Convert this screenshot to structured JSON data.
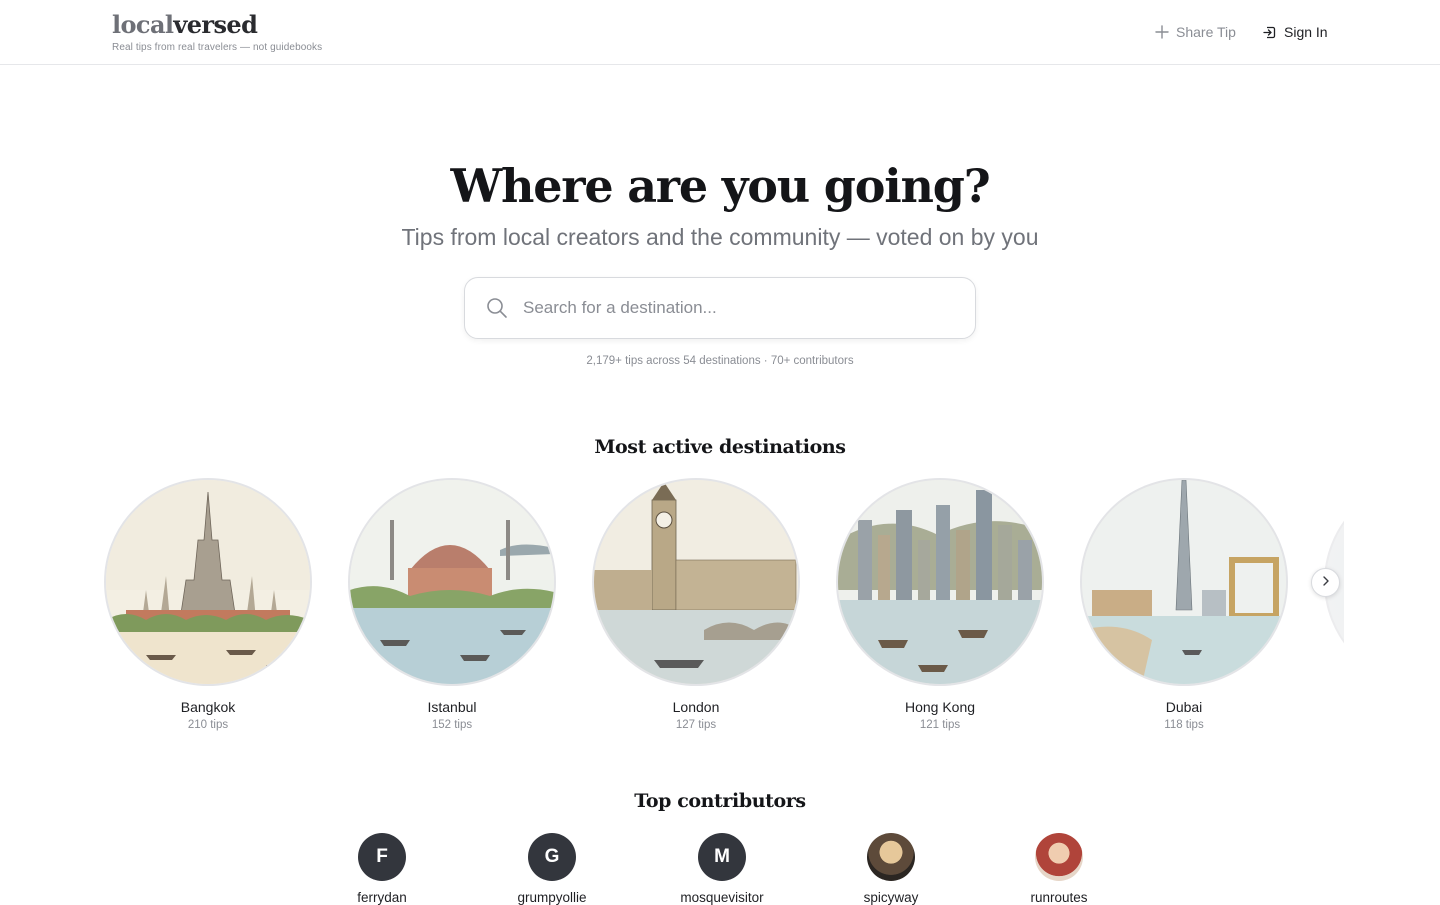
{
  "header": {
    "logo_part1": "local",
    "logo_part2": "versed",
    "tagline": "Real tips from real travelers — not guidebooks",
    "share_label": "Share Tip",
    "signin_label": "Sign In"
  },
  "hero": {
    "title": "Where are you going?",
    "subtitle": "Tips from local creators and the community — voted on by you",
    "search_placeholder": "Search for a destination...",
    "stats": "2,179+ tips across 54 destinations · 70+ contributors"
  },
  "destinations": {
    "title": "Most active destinations",
    "items": [
      {
        "name": "Bangkok",
        "count": "210 tips"
      },
      {
        "name": "Istanbul",
        "count": "152 tips"
      },
      {
        "name": "London",
        "count": "127 tips"
      },
      {
        "name": "Hong Kong",
        "count": "121 tips"
      },
      {
        "name": "Dubai",
        "count": "118 tips"
      }
    ]
  },
  "contributors": {
    "title": "Top contributors",
    "items": [
      {
        "initial": "F",
        "name": "ferrydan"
      },
      {
        "initial": "G",
        "name": "grumpyollie"
      },
      {
        "initial": "M",
        "name": "mosquevisitor"
      },
      {
        "initial": "",
        "name": "spicyway"
      },
      {
        "initial": "",
        "name": "runroutes"
      }
    ]
  },
  "colors": {
    "text": "#1f2024",
    "muted": "#8a8d94",
    "border": "#e6e7ea",
    "avatar_bg": "#33363d"
  },
  "icons": {
    "share": "plus-icon",
    "signin": "sign-in-icon",
    "search": "search-icon",
    "next": "chevron-right-icon"
  }
}
